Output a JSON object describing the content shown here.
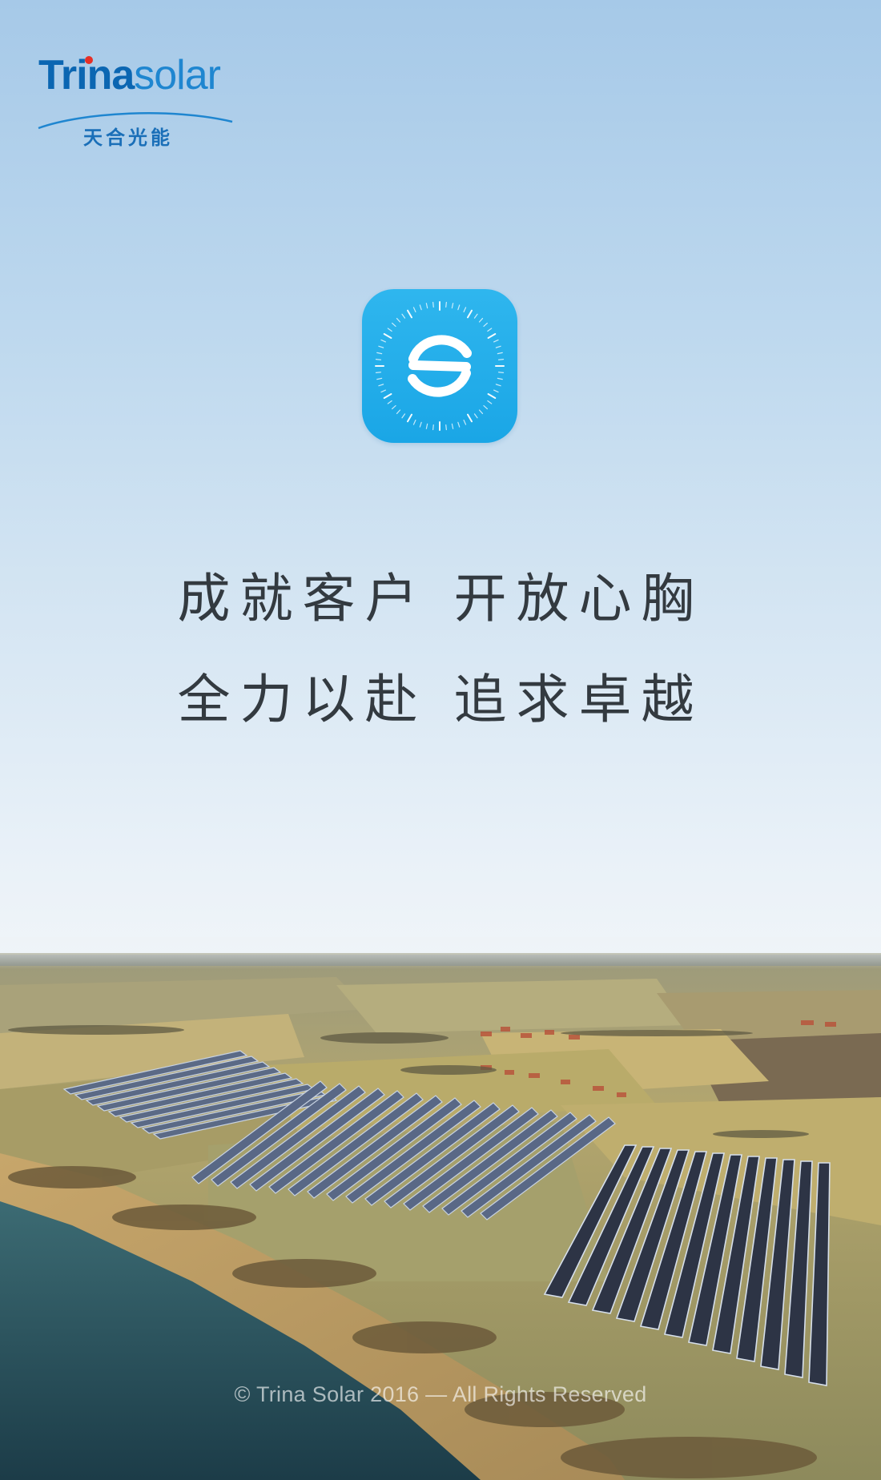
{
  "logo": {
    "brand_bold": "Trina",
    "brand_light": "solar",
    "brand_cn": "天合光能",
    "colors": {
      "primary": "#0b66b2",
      "secondary": "#1f86d0",
      "dot": "#e63027"
    }
  },
  "app_icon": {
    "icon": "solar-s-dial-icon",
    "background": "#1fa9e8"
  },
  "slogan": {
    "line1": "成就客户 开放心胸",
    "line2": "全力以赴 追求卓越"
  },
  "footer": {
    "copyright": "© Trina Solar 2016 — All Rights Reserved"
  }
}
